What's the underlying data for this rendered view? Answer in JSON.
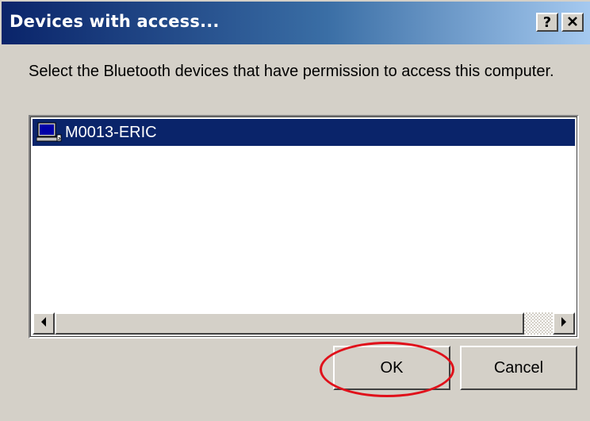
{
  "window": {
    "title": "Devices with access...",
    "help_glyph": "?",
    "close_glyph": "✕"
  },
  "dialog": {
    "instruction": "Select the Bluetooth devices that have permission to access this computer."
  },
  "device_list": {
    "items": [
      {
        "label": "M0013-ERIC",
        "icon": "computer-icon",
        "selected": true
      }
    ]
  },
  "scrollbar": {
    "left_arrow": "◀",
    "right_arrow": "▶"
  },
  "buttons": {
    "ok_label": "OK",
    "cancel_label": "Cancel"
  },
  "colors": {
    "titlebar_start": "#0a246a",
    "titlebar_end": "#a6caf0",
    "selection": "#0a246a",
    "dialog_face": "#d4d0c8",
    "annotation_circle": "#e0101a"
  }
}
